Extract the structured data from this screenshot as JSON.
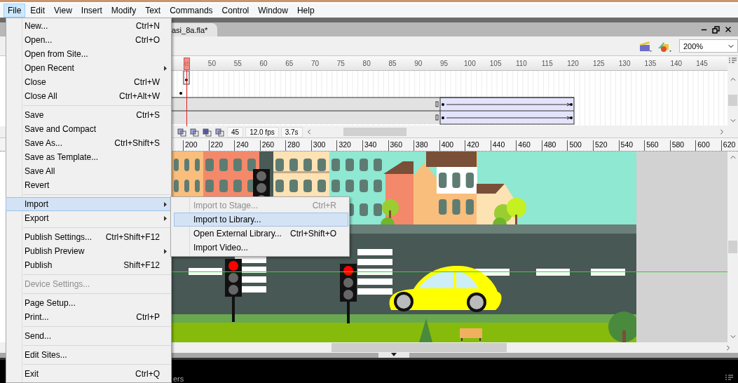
{
  "menubar": [
    {
      "label": "File",
      "selected": true
    },
    {
      "label": "Edit",
      "selected": false
    },
    {
      "label": "View",
      "selected": false
    },
    {
      "label": "Insert",
      "selected": false
    },
    {
      "label": "Modify",
      "selected": false
    },
    {
      "label": "Text",
      "selected": false
    },
    {
      "label": "Commands",
      "selected": false
    },
    {
      "label": "Control",
      "selected": false
    },
    {
      "label": "Window",
      "selected": false
    },
    {
      "label": "Help",
      "selected": false
    }
  ],
  "file_menu": [
    {
      "kind": "item",
      "label": "New...",
      "shortcut": "Ctrl+N",
      "submenu": false,
      "disabled": false,
      "selected": false
    },
    {
      "kind": "item",
      "label": "Open...",
      "shortcut": "Ctrl+O",
      "submenu": false,
      "disabled": false,
      "selected": false
    },
    {
      "kind": "item",
      "label": "Open from Site...",
      "submenu": false,
      "disabled": false,
      "selected": false
    },
    {
      "kind": "item",
      "label": "Open Recent",
      "submenu": true,
      "disabled": false,
      "selected": false
    },
    {
      "kind": "item",
      "label": "Close",
      "shortcut": "Ctrl+W",
      "submenu": false,
      "disabled": false,
      "selected": false
    },
    {
      "kind": "item",
      "label": "Close All",
      "shortcut": "Ctrl+Alt+W",
      "submenu": false,
      "disabled": false,
      "selected": false
    },
    {
      "kind": "separator"
    },
    {
      "kind": "item",
      "label": "Save",
      "shortcut": "Ctrl+S",
      "submenu": false,
      "disabled": false,
      "selected": false
    },
    {
      "kind": "item",
      "label": "Save and Compact",
      "submenu": false,
      "disabled": false,
      "selected": false
    },
    {
      "kind": "item",
      "label": "Save As...",
      "shortcut": "Ctrl+Shift+S",
      "submenu": false,
      "disabled": false,
      "selected": false
    },
    {
      "kind": "item",
      "label": "Save as Template...",
      "submenu": false,
      "disabled": false,
      "selected": false
    },
    {
      "kind": "item",
      "label": "Save All",
      "submenu": false,
      "disabled": false,
      "selected": false
    },
    {
      "kind": "item",
      "label": "Revert",
      "submenu": false,
      "disabled": false,
      "selected": false
    },
    {
      "kind": "separator"
    },
    {
      "kind": "item",
      "label": "Import",
      "submenu": true,
      "disabled": false,
      "selected": true
    },
    {
      "kind": "item",
      "label": "Export",
      "submenu": true,
      "disabled": false,
      "selected": false
    },
    {
      "kind": "separator"
    },
    {
      "kind": "item",
      "label": "Publish Settings...",
      "shortcut": "Ctrl+Shift+F12",
      "submenu": false,
      "disabled": false,
      "selected": false
    },
    {
      "kind": "item",
      "label": "Publish Preview",
      "submenu": true,
      "disabled": false,
      "selected": false
    },
    {
      "kind": "item",
      "label": "Publish",
      "shortcut": "Shift+F12",
      "submenu": false,
      "disabled": false,
      "selected": false
    },
    {
      "kind": "separator"
    },
    {
      "kind": "item",
      "label": "Device Settings...",
      "submenu": false,
      "disabled": true,
      "selected": false
    },
    {
      "kind": "separator"
    },
    {
      "kind": "item",
      "label": "Page Setup...",
      "submenu": false,
      "disabled": false,
      "selected": false
    },
    {
      "kind": "item",
      "label": "Print...",
      "shortcut": "Ctrl+P",
      "submenu": false,
      "disabled": false,
      "selected": false
    },
    {
      "kind": "separator"
    },
    {
      "kind": "item",
      "label": "Send...",
      "submenu": false,
      "disabled": false,
      "selected": false
    },
    {
      "kind": "separator"
    },
    {
      "kind": "item",
      "label": "Edit Sites...",
      "submenu": false,
      "disabled": false,
      "selected": false
    },
    {
      "kind": "separator"
    },
    {
      "kind": "item",
      "label": "Exit",
      "shortcut": "Ctrl+Q",
      "submenu": false,
      "disabled": false,
      "selected": false
    }
  ],
  "import_submenu": [
    {
      "label": "Import to Stage...",
      "shortcut": "Ctrl+R",
      "disabled": true,
      "selected": false
    },
    {
      "label": "Import to Library...",
      "disabled": false,
      "selected": true
    },
    {
      "label": "Open External Library...",
      "shortcut": "Ctrl+Shift+O",
      "disabled": false,
      "selected": false
    },
    {
      "label": "Import Video...",
      "disabled": false,
      "selected": false
    }
  ],
  "document": {
    "tab": "asi_8a.fla*",
    "zoom": "200%"
  },
  "timeline": {
    "playhead_label": "45",
    "frame_labels": [
      "50",
      "55",
      "60",
      "65",
      "70",
      "75",
      "80",
      "85",
      "90",
      "95",
      "100",
      "105",
      "110",
      "115",
      "120",
      "125",
      "130",
      "135",
      "140",
      "145"
    ],
    "current_frame": "45",
    "fps": "12.0 fps",
    "time": "3.7s"
  },
  "stage_ruler": [
    "200",
    "220",
    "240",
    "260",
    "280",
    "300",
    "320",
    "340",
    "360",
    "380",
    "400",
    "420",
    "440",
    "460",
    "480",
    "500",
    "520",
    "540",
    "560",
    "580",
    "600",
    "620"
  ],
  "panel": {
    "label": "ers"
  }
}
